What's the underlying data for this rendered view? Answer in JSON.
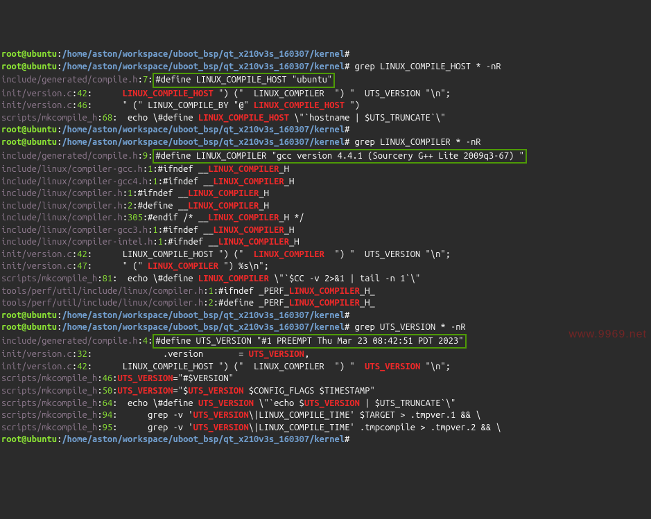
{
  "watermark": "www.9969.net",
  "lines": [
    {
      "segs": [
        {
          "cls": "prompt-user",
          "t": "root@ubuntu"
        },
        {
          "cls": "white",
          "t": ":"
        },
        {
          "cls": "prompt-path",
          "t": "/home/aston/workspace/uboot_bsp/qt_x210v3s_160307/kernel"
        },
        {
          "cls": "white",
          "t": "#"
        }
      ]
    },
    {
      "segs": [
        {
          "cls": "prompt-user",
          "t": "root@ubuntu"
        },
        {
          "cls": "white",
          "t": ":"
        },
        {
          "cls": "prompt-path",
          "t": "/home/aston/workspace/uboot_bsp/qt_x210v3s_160307/kernel"
        },
        {
          "cls": "white",
          "t": "# grep LINUX_COMPILE_HOST * -nR"
        }
      ]
    },
    {
      "segs": [
        {
          "cls": "filename",
          "t": "include/generated/compile.h"
        },
        {
          "cls": "white",
          "t": ":"
        },
        {
          "cls": "linenum",
          "t": "7"
        },
        {
          "cls": "white",
          "t": ":"
        },
        {
          "cls": "boxed",
          "t": "#define LINUX_COMPILE_HOST \"ubuntu\""
        }
      ]
    },
    {
      "segs": [
        {
          "cls": "filename",
          "t": "init/version.c"
        },
        {
          "cls": "white",
          "t": ":"
        },
        {
          "cls": "linenum",
          "t": "42"
        },
        {
          "cls": "white",
          "t": ":      "
        },
        {
          "cls": "hl",
          "t": "LINUX_COMPILE_HOST"
        },
        {
          "cls": "white",
          "t": " \") (\"  LINUX_COMPILER  \") \"  UTS_VERSION \"\\n\";"
        }
      ]
    },
    {
      "segs": [
        {
          "cls": "filename",
          "t": "init/version.c"
        },
        {
          "cls": "white",
          "t": ":"
        },
        {
          "cls": "linenum",
          "t": "46"
        },
        {
          "cls": "white",
          "t": ":      \" (\" LINUX_COMPILE_BY \"@\" "
        },
        {
          "cls": "hl",
          "t": "LINUX_COMPILE_HOST"
        },
        {
          "cls": "white",
          "t": " \")"
        }
      ]
    },
    {
      "segs": [
        {
          "cls": "filename",
          "t": "scripts/mkcompile_h"
        },
        {
          "cls": "white",
          "t": ":"
        },
        {
          "cls": "linenum",
          "t": "68"
        },
        {
          "cls": "white",
          "t": ":  echo \\#define "
        },
        {
          "cls": "hl",
          "t": "LINUX_COMPILE_HOST"
        },
        {
          "cls": "white",
          "t": " \\\"`hostname | $UTS_TRUNCATE`\\\""
        }
      ]
    },
    {
      "segs": [
        {
          "cls": "prompt-user",
          "t": "root@ubuntu"
        },
        {
          "cls": "white",
          "t": ":"
        },
        {
          "cls": "prompt-path",
          "t": "/home/aston/workspace/uboot_bsp/qt_x210v3s_160307/kernel"
        },
        {
          "cls": "white",
          "t": "#"
        }
      ]
    },
    {
      "segs": [
        {
          "cls": "prompt-user",
          "t": "root@ubuntu"
        },
        {
          "cls": "white",
          "t": ":"
        },
        {
          "cls": "prompt-path",
          "t": "/home/aston/workspace/uboot_bsp/qt_x210v3s_160307/kernel"
        },
        {
          "cls": "white",
          "t": "# grep LINUX_COMPILER * -nR"
        }
      ]
    },
    {
      "segs": [
        {
          "cls": "filename",
          "t": "include/generated/compile.h"
        },
        {
          "cls": "white",
          "t": ":"
        },
        {
          "cls": "linenum",
          "t": "9"
        },
        {
          "cls": "white",
          "t": ":"
        },
        {
          "cls": "boxed",
          "t": "#define LINUX_COMPILER \"gcc version 4.4.1 (Sourcery G++ Lite 2009q3-67) \""
        }
      ]
    },
    {
      "segs": [
        {
          "cls": "filename",
          "t": "include/linux/compiler-gcc.h"
        },
        {
          "cls": "white",
          "t": ":"
        },
        {
          "cls": "linenum",
          "t": "1"
        },
        {
          "cls": "white",
          "t": ":#ifndef __"
        },
        {
          "cls": "hl",
          "t": "LINUX_COMPILER"
        },
        {
          "cls": "white",
          "t": "_H"
        }
      ]
    },
    {
      "segs": [
        {
          "cls": "filename",
          "t": "include/linux/compiler-gcc4.h"
        },
        {
          "cls": "white",
          "t": ":"
        },
        {
          "cls": "linenum",
          "t": "1"
        },
        {
          "cls": "white",
          "t": ":#ifndef __"
        },
        {
          "cls": "hl",
          "t": "LINUX_COMPILER"
        },
        {
          "cls": "white",
          "t": "_H"
        }
      ]
    },
    {
      "segs": [
        {
          "cls": "filename",
          "t": "include/linux/compiler.h"
        },
        {
          "cls": "white",
          "t": ":"
        },
        {
          "cls": "linenum",
          "t": "1"
        },
        {
          "cls": "white",
          "t": ":#ifndef __"
        },
        {
          "cls": "hl",
          "t": "LINUX_COMPILER"
        },
        {
          "cls": "white",
          "t": "_H"
        }
      ]
    },
    {
      "segs": [
        {
          "cls": "filename",
          "t": "include/linux/compiler.h"
        },
        {
          "cls": "white",
          "t": ":"
        },
        {
          "cls": "linenum",
          "t": "2"
        },
        {
          "cls": "white",
          "t": ":#define __"
        },
        {
          "cls": "hl",
          "t": "LINUX_COMPILER"
        },
        {
          "cls": "white",
          "t": "_H"
        }
      ]
    },
    {
      "segs": [
        {
          "cls": "filename",
          "t": "include/linux/compiler.h"
        },
        {
          "cls": "white",
          "t": ":"
        },
        {
          "cls": "linenum",
          "t": "305"
        },
        {
          "cls": "white",
          "t": ":#endif /* __"
        },
        {
          "cls": "hl",
          "t": "LINUX_COMPILER"
        },
        {
          "cls": "white",
          "t": "_H */"
        }
      ]
    },
    {
      "segs": [
        {
          "cls": "filename",
          "t": "include/linux/compiler-gcc3.h"
        },
        {
          "cls": "white",
          "t": ":"
        },
        {
          "cls": "linenum",
          "t": "1"
        },
        {
          "cls": "white",
          "t": ":#ifndef __"
        },
        {
          "cls": "hl",
          "t": "LINUX_COMPILER"
        },
        {
          "cls": "white",
          "t": "_H"
        }
      ]
    },
    {
      "segs": [
        {
          "cls": "filename",
          "t": "include/linux/compiler-intel.h"
        },
        {
          "cls": "white",
          "t": ":"
        },
        {
          "cls": "linenum",
          "t": "1"
        },
        {
          "cls": "white",
          "t": ":#ifndef __"
        },
        {
          "cls": "hl",
          "t": "LINUX_COMPILER"
        },
        {
          "cls": "white",
          "t": "_H"
        }
      ]
    },
    {
      "segs": [
        {
          "cls": "filename",
          "t": "init/version.c"
        },
        {
          "cls": "white",
          "t": ":"
        },
        {
          "cls": "linenum",
          "t": "42"
        },
        {
          "cls": "white",
          "t": ":      LINUX_COMPILE_HOST \") (\"  "
        },
        {
          "cls": "hl",
          "t": "LINUX_COMPILER"
        },
        {
          "cls": "white",
          "t": "  \") \"  UTS_VERSION \"\\n\";"
        }
      ]
    },
    {
      "segs": [
        {
          "cls": "filename",
          "t": "init/version.c"
        },
        {
          "cls": "white",
          "t": ":"
        },
        {
          "cls": "linenum",
          "t": "47"
        },
        {
          "cls": "white",
          "t": ":      \" (\" "
        },
        {
          "cls": "hl",
          "t": "LINUX_COMPILER"
        },
        {
          "cls": "white",
          "t": " \") %s\\n\";"
        }
      ]
    },
    {
      "segs": [
        {
          "cls": "filename",
          "t": "scripts/mkcompile_h"
        },
        {
          "cls": "white",
          "t": ":"
        },
        {
          "cls": "linenum",
          "t": "81"
        },
        {
          "cls": "white",
          "t": ":  echo \\#define "
        },
        {
          "cls": "hl",
          "t": "LINUX_COMPILER"
        },
        {
          "cls": "white",
          "t": " \\\"`$CC -v 2>&1 | tail -n 1`\\\""
        }
      ]
    },
    {
      "segs": [
        {
          "cls": "filename",
          "t": "tools/perf/util/include/linux/compiler.h"
        },
        {
          "cls": "white",
          "t": ":"
        },
        {
          "cls": "linenum",
          "t": "1"
        },
        {
          "cls": "white",
          "t": ":#ifndef _PERF_"
        },
        {
          "cls": "hl",
          "t": "LINUX_COMPILER"
        },
        {
          "cls": "white",
          "t": "_H_"
        }
      ]
    },
    {
      "segs": [
        {
          "cls": "filename",
          "t": "tools/perf/util/include/linux/compiler.h"
        },
        {
          "cls": "white",
          "t": ":"
        },
        {
          "cls": "linenum",
          "t": "2"
        },
        {
          "cls": "white",
          "t": ":#define _PERF_"
        },
        {
          "cls": "hl",
          "t": "LINUX_COMPILER"
        },
        {
          "cls": "white",
          "t": "_H_"
        }
      ]
    },
    {
      "segs": [
        {
          "cls": "prompt-user",
          "t": "root@ubuntu"
        },
        {
          "cls": "white",
          "t": ":"
        },
        {
          "cls": "prompt-path",
          "t": "/home/aston/workspace/uboot_bsp/qt_x210v3s_160307/kernel"
        },
        {
          "cls": "white",
          "t": "#"
        }
      ]
    },
    {
      "segs": [
        {
          "cls": "prompt-user",
          "t": "root@ubuntu"
        },
        {
          "cls": "white",
          "t": ":"
        },
        {
          "cls": "prompt-path",
          "t": "/home/aston/workspace/uboot_bsp/qt_x210v3s_160307/kernel"
        },
        {
          "cls": "white",
          "t": "# grep UTS_VERSION * -nR"
        }
      ]
    },
    {
      "segs": [
        {
          "cls": "filename",
          "t": "include/generated/compile.h"
        },
        {
          "cls": "white",
          "t": ":"
        },
        {
          "cls": "linenum",
          "t": "4"
        },
        {
          "cls": "white",
          "t": ":"
        },
        {
          "cls": "boxed",
          "t": "#define UTS_VERSION \"#1 PREEMPT Thu Mar 23 08:42:51 PDT 2023\""
        }
      ]
    },
    {
      "segs": [
        {
          "cls": "filename",
          "t": "init/version.c"
        },
        {
          "cls": "white",
          "t": ":"
        },
        {
          "cls": "linenum",
          "t": "32"
        },
        {
          "cls": "white",
          "t": ":              .version       = "
        },
        {
          "cls": "hl",
          "t": "UTS_VERSION"
        },
        {
          "cls": "white",
          "t": ","
        }
      ]
    },
    {
      "segs": [
        {
          "cls": "filename",
          "t": "init/version.c"
        },
        {
          "cls": "white",
          "t": ":"
        },
        {
          "cls": "linenum",
          "t": "42"
        },
        {
          "cls": "white",
          "t": ":      LINUX_COMPILE_HOST \") (\"  LINUX_COMPILER  \") \"  "
        },
        {
          "cls": "hl",
          "t": "UTS_VERSION"
        },
        {
          "cls": "white",
          "t": " \"\\n\";"
        }
      ]
    },
    {
      "segs": [
        {
          "cls": "filename",
          "t": "scripts/mkcompile_h"
        },
        {
          "cls": "white",
          "t": ":"
        },
        {
          "cls": "linenum",
          "t": "46"
        },
        {
          "cls": "white",
          "t": ":"
        },
        {
          "cls": "hl",
          "t": "UTS_VERSION"
        },
        {
          "cls": "white",
          "t": "=\"#$VERSION\""
        }
      ]
    },
    {
      "segs": [
        {
          "cls": "filename",
          "t": "scripts/mkcompile_h"
        },
        {
          "cls": "white",
          "t": ":"
        },
        {
          "cls": "linenum",
          "t": "50"
        },
        {
          "cls": "white",
          "t": ":"
        },
        {
          "cls": "hl",
          "t": "UTS_VERSION"
        },
        {
          "cls": "white",
          "t": "=\"$"
        },
        {
          "cls": "hl",
          "t": "UTS_VERSION"
        },
        {
          "cls": "white",
          "t": " $CONFIG_FLAGS $TIMESTAMP\""
        }
      ]
    },
    {
      "segs": [
        {
          "cls": "filename",
          "t": "scripts/mkcompile_h"
        },
        {
          "cls": "white",
          "t": ":"
        },
        {
          "cls": "linenum",
          "t": "64"
        },
        {
          "cls": "white",
          "t": ":  echo \\#define "
        },
        {
          "cls": "hl",
          "t": "UTS_VERSION"
        },
        {
          "cls": "white",
          "t": " \\\"`echo $"
        },
        {
          "cls": "hl",
          "t": "UTS_VERSION"
        },
        {
          "cls": "white",
          "t": " | $UTS_TRUNCATE`\\\""
        }
      ]
    },
    {
      "segs": [
        {
          "cls": "filename",
          "t": "scripts/mkcompile_h"
        },
        {
          "cls": "white",
          "t": ":"
        },
        {
          "cls": "linenum",
          "t": "94"
        },
        {
          "cls": "white",
          "t": ":      grep -v '"
        },
        {
          "cls": "hl",
          "t": "UTS_VERSION"
        },
        {
          "cls": "white",
          "t": "\\|LINUX_COMPILE_TIME' $TARGET > .tmpver.1 && \\"
        }
      ]
    },
    {
      "segs": [
        {
          "cls": "filename",
          "t": "scripts/mkcompile_h"
        },
        {
          "cls": "white",
          "t": ":"
        },
        {
          "cls": "linenum",
          "t": "95"
        },
        {
          "cls": "white",
          "t": ":      grep -v '"
        },
        {
          "cls": "hl",
          "t": "UTS_VERSION"
        },
        {
          "cls": "white",
          "t": "\\|LINUX_COMPILE_TIME' .tmpcompile > .tmpver.2 && \\"
        }
      ]
    },
    {
      "segs": [
        {
          "cls": "prompt-user",
          "t": "root@ubuntu"
        },
        {
          "cls": "white",
          "t": ":"
        },
        {
          "cls": "prompt-path",
          "t": "/home/aston/workspace/uboot_bsp/qt_x210v3s_160307/kernel"
        },
        {
          "cls": "white",
          "t": "#"
        }
      ]
    }
  ]
}
